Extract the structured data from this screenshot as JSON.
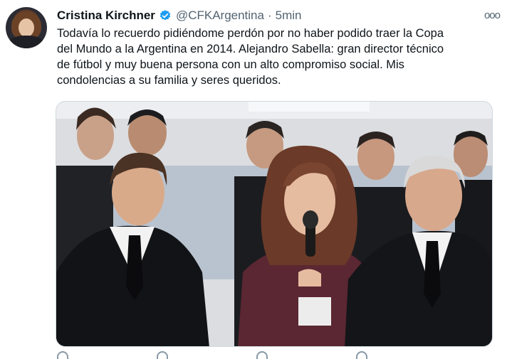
{
  "tweet": {
    "author_name": "Cristina Kirchner",
    "handle": "@CFKArgentina",
    "separator": "·",
    "time": "5min",
    "more_label": "ooo",
    "text": "Todavía lo recuerdo pidiéndome perdón por no haber podido traer la Copa\ndel Mundo a la Argentina en 2014. Alejandro Sabella: gran director técnico\nde fútbol y muy buena persona con un alto compromiso social. Mis\ncondolencias a su familia y seres queridos."
  },
  "icons": {
    "verified": "verified-badge-icon",
    "more": "more-options-icon"
  },
  "colors": {
    "verified_blue": "#1d9bf0",
    "text_primary": "#0f1419",
    "text_secondary": "#536471",
    "border": "#cfd9de"
  }
}
